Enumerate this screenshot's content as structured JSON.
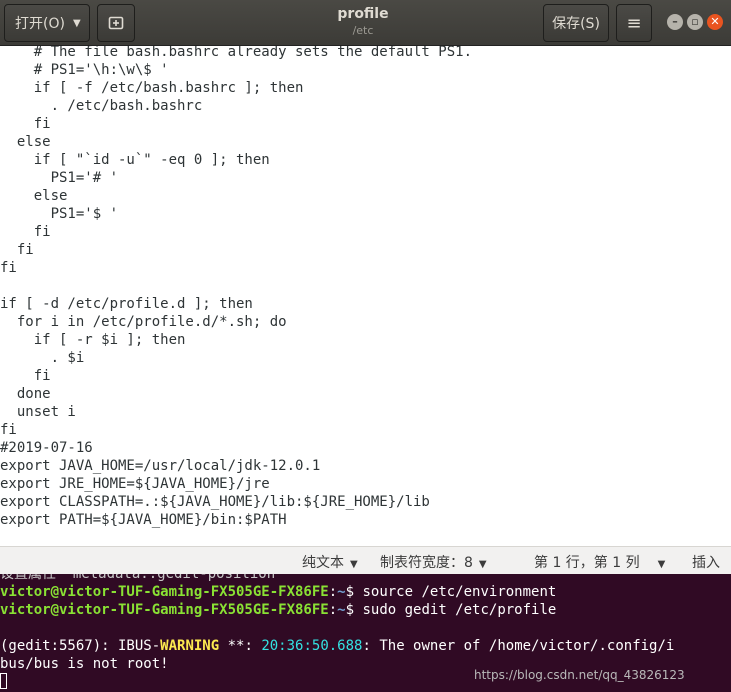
{
  "header": {
    "open_label": "打开(O)",
    "title": "profile",
    "subtitle": "/etc",
    "save_label": "保存(S)"
  },
  "editor": {
    "lines": [
      "    # The file bash.bashrc already sets the default PS1.",
      "    # PS1='\\h:\\w\\$ '",
      "    if [ -f /etc/bash.bashrc ]; then",
      "      . /etc/bash.bashrc",
      "    fi",
      "  else",
      "    if [ \"`id -u`\" -eq 0 ]; then",
      "      PS1='# '",
      "    else",
      "      PS1='$ '",
      "    fi",
      "  fi",
      "fi",
      "",
      "if [ -d /etc/profile.d ]; then",
      "  for i in /etc/profile.d/*.sh; do",
      "    if [ -r $i ]; then",
      "      . $i",
      "    fi",
      "  done",
      "  unset i",
      "fi",
      "#2019-07-16",
      "export JAVA_HOME=/usr/local/jdk-12.0.1",
      "export JRE_HOME=${JAVA_HOME}/jre",
      "export CLASSPATH=.:${JAVA_HOME}/lib:${JRE_HOME}/lib",
      "export PATH=${JAVA_HOME}/bin:$PATH"
    ]
  },
  "statusbar": {
    "language": "纯文本",
    "tab_width": "制表符宽度：8",
    "position": "第 1 行，第 1 列",
    "mode": "插入"
  },
  "terminal": {
    "partial_line": "设置属性 \"metadata::gedit-position\"",
    "prompt_user": "victor@victor-TUF-Gaming-FX505GE-FX86FE",
    "prompt_path": "~",
    "cmd1": "$ source /etc/environment",
    "cmd2": "$ sudo gedit /etc/profile",
    "warn_prefix": "(gedit:5567): IBUS-",
    "warn_word": "WARNING",
    "warn_mid": " **: ",
    "warn_time": "20:36:50.688",
    "warn_msg": ": The owner of /home/victor/.config/i",
    "warn_cont": "bus/bus is not root!",
    "watermark": "https://blog.csdn.net/qq_43826123"
  }
}
